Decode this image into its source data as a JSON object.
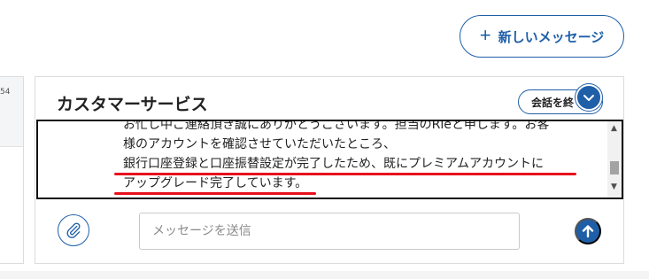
{
  "header": {
    "new_message_label": "新しいメッセージ",
    "new_message_icon": "plus-icon"
  },
  "left_panel": {
    "time_fragment": "54"
  },
  "chat": {
    "title": "カスタマーサービス",
    "end_chat_label": "会話を終",
    "collapse_icon": "chevron-down-icon",
    "message_lines": [
      "お忙し中ご連絡頂き誠にありがとうございます。担当のRieと申します。お客",
      "様のアカウントを確認させていただいたところ、",
      "銀行口座登録と口座振替設定が完了したため、既にプレミアムアカウントに",
      "アップグレード完了しています。"
    ],
    "attach_icon": "paperclip-icon",
    "input_value": "",
    "input_placeholder": "メッセージを送信",
    "send_icon": "arrow-up-icon"
  },
  "colors": {
    "accent": "#1f5fa8",
    "highlight_underline": "#e8101c",
    "border": "#dcdcdc"
  }
}
